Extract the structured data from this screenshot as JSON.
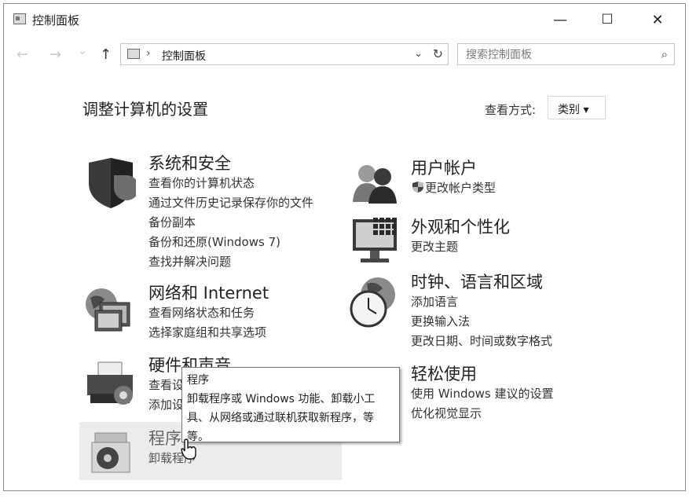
{
  "window": {
    "title": "控制面板",
    "minimize": "—",
    "maximize": "☐",
    "close": "✕"
  },
  "nav": {
    "back": "←",
    "forward": "→",
    "recent": "⌄",
    "up": "↑"
  },
  "address": {
    "separator": "›",
    "path": "控制面板",
    "dropdown": "⌄",
    "refresh": "↻"
  },
  "search": {
    "placeholder": "搜索控制面板",
    "icon": "⌕"
  },
  "heading": "调整计算机的设置",
  "view_by": {
    "label": "查看方式:",
    "value": "类别 ▾"
  },
  "categories": {
    "system": {
      "title": "系统和安全",
      "links": [
        "查看你的计算机状态",
        "通过文件历史记录保存你的文件",
        "备份副本",
        "备份和还原(Windows 7)",
        "查找并解决问题"
      ]
    },
    "network": {
      "title": "网络和 Internet",
      "links": [
        "查看网络状态和任务",
        "选择家庭组和共享选项"
      ]
    },
    "hardware": {
      "title": "硬件和声音",
      "links": [
        "查看设",
        "添加设"
      ]
    },
    "programs": {
      "title": "程序",
      "links": [
        "卸载程序"
      ]
    },
    "users": {
      "title": "用户帐户",
      "links": [
        "更改帐户类型"
      ]
    },
    "appearance": {
      "title": "外观和个性化",
      "links": [
        "更改主题"
      ]
    },
    "clock": {
      "title": "时钟、语言和区域",
      "links": [
        "添加语言",
        "更换输入法",
        "更改日期、时间或数字格式"
      ]
    },
    "ease": {
      "title": "轻松使用",
      "links": [
        "使用 Windows 建议的设置",
        "优化视觉显示"
      ]
    }
  },
  "tooltip": {
    "title": "程序",
    "text": "卸载程序或 Windows 功能、卸载小工具、从网络或通过联机获取新程序，等等。"
  }
}
